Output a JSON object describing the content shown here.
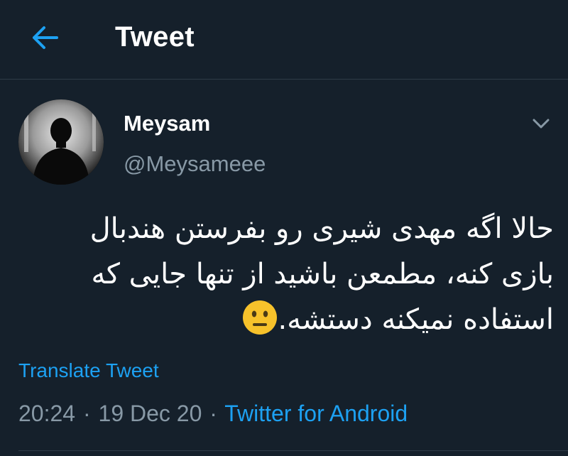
{
  "header": {
    "title": "Tweet",
    "back_icon": "arrow-left-icon"
  },
  "author": {
    "display_name": "Meysam",
    "handle": "@Meysameee",
    "avatar_icon": "person-silhouette-avatar"
  },
  "menu_icon": "chevron-down-icon",
  "tweet": {
    "lines": [
      "حالا اگه مهدی شیری رو بفرستن هندبال",
      "بازی کنه، مطمعن باشید از تنها جایی که",
      "استفاده نمیکنه دستشه."
    ],
    "emoji": "neutral-face-emoji"
  },
  "translate_label": "Translate Tweet",
  "meta": {
    "time": "20:24",
    "separator": "·",
    "date": "19 Dec 20",
    "source": "Twitter for Android"
  },
  "colors": {
    "background": "#15202b",
    "accent": "#1da1f2",
    "secondary_text": "#8899a6",
    "divider": "#2f3b47"
  }
}
